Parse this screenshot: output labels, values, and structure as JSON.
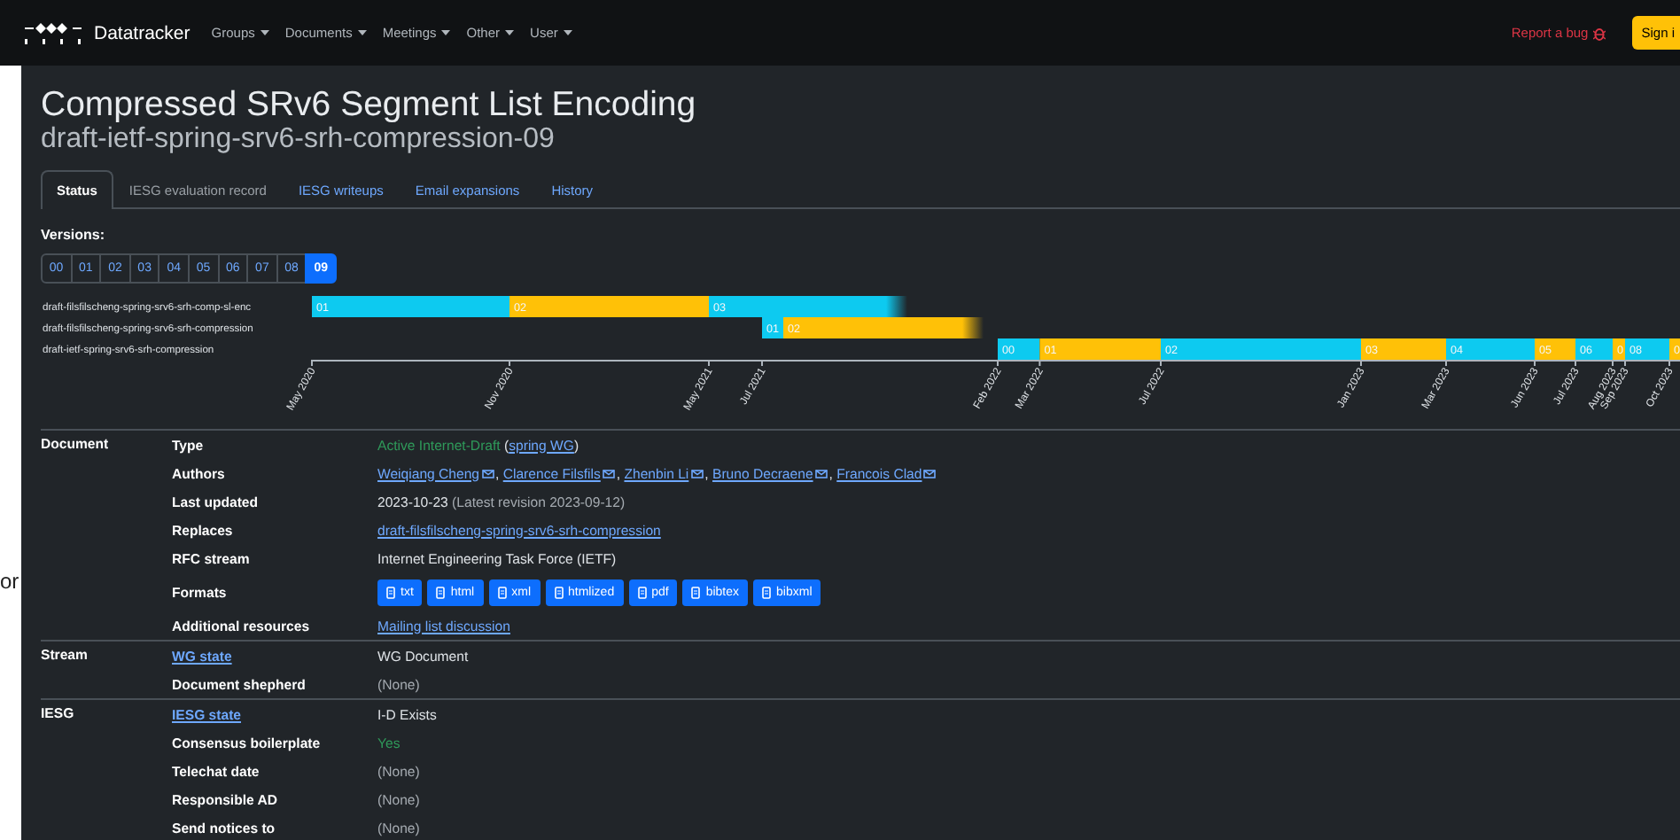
{
  "nav": {
    "brand": "Datatracker",
    "menus": [
      "Groups",
      "Documents",
      "Meetings",
      "Other",
      "User"
    ],
    "report_link": "Report a bug",
    "sign_in": "Sign i"
  },
  "background_text": "or",
  "title": "Compressed SRv6 Segment List Encoding",
  "subtitle": "draft-ietf-spring-srv6-srh-compression-09",
  "tabs": [
    {
      "label": "Status",
      "selected": true,
      "disabled": false
    },
    {
      "label": "IESG evaluation record",
      "selected": false,
      "disabled": true
    },
    {
      "label": "IESG writeups",
      "selected": false,
      "disabled": false
    },
    {
      "label": "Email expansions",
      "selected": false,
      "disabled": false
    },
    {
      "label": "History",
      "selected": false,
      "disabled": false
    }
  ],
  "versions": {
    "label": "Versions:",
    "items": [
      {
        "label": "00",
        "selected": false
      },
      {
        "label": "01",
        "selected": false
      },
      {
        "label": "02",
        "selected": false
      },
      {
        "label": "03",
        "selected": false
      },
      {
        "label": "04",
        "selected": false
      },
      {
        "label": "05",
        "selected": false
      },
      {
        "label": "06",
        "selected": false
      },
      {
        "label": "07",
        "selected": false
      },
      {
        "label": "08",
        "selected": false
      },
      {
        "label": "09",
        "selected": true
      }
    ]
  },
  "timeline": {
    "ticks": [
      "May 2020",
      "Nov 2020",
      "May 2021",
      "Jul 2021",
      "Feb 2022",
      "Mar 2022",
      "Jul 2022",
      "Jan 2023",
      "Mar 2023",
      "Jun 2023",
      "Jul 2023",
      "Aug 2023",
      "Sep 2023",
      "Oct 2023"
    ],
    "rows": [
      {
        "name": "draft-filsfilscheng-spring-srv6-srh-comp-sl-enc",
        "segments": [
          {
            "label": "01",
            "fade": false
          },
          {
            "label": "02",
            "fade": false
          },
          {
            "label": "03",
            "fade": true
          }
        ]
      },
      {
        "name": "draft-filsfilscheng-spring-srv6-srh-compression",
        "segments": [
          {
            "label": "01",
            "fade": false
          },
          {
            "label": "02",
            "fade": true
          }
        ]
      },
      {
        "name": "draft-ietf-spring-srv6-srh-compression",
        "segments": [
          {
            "label": "00",
            "fade": false
          },
          {
            "label": "01",
            "fade": false
          },
          {
            "label": "02",
            "fade": false
          },
          {
            "label": "03",
            "fade": false
          },
          {
            "label": "04",
            "fade": false
          },
          {
            "label": "05",
            "fade": false
          },
          {
            "label": "06",
            "fade": false
          },
          {
            "label": "0",
            "fade": false
          },
          {
            "label": "08",
            "fade": false
          },
          {
            "label": "0",
            "fade": false
          }
        ]
      }
    ]
  },
  "sections": [
    {
      "name": "Document",
      "rows": [
        {
          "label": "Type",
          "link": false,
          "value": [
            {
              "kind": "status",
              "text": "Active Internet-Draft"
            },
            {
              "kind": "plain",
              "text": " ("
            },
            {
              "kind": "link",
              "text": "spring WG"
            },
            {
              "kind": "plain",
              "text": ")"
            }
          ]
        },
        {
          "label": "Authors",
          "link": false,
          "value": [
            {
              "kind": "author",
              "text": "Weiqiang Cheng"
            },
            {
              "kind": "plain",
              "text": ", "
            },
            {
              "kind": "author",
              "text": "Clarence Filsfils"
            },
            {
              "kind": "plain",
              "text": ", "
            },
            {
              "kind": "author",
              "text": "Zhenbin Li"
            },
            {
              "kind": "plain",
              "text": ", "
            },
            {
              "kind": "author",
              "text": "Bruno Decraene"
            },
            {
              "kind": "plain",
              "text": ", "
            },
            {
              "kind": "author",
              "text": "Francois Clad"
            }
          ]
        },
        {
          "label": "Last updated",
          "link": false,
          "value": [
            {
              "kind": "plain",
              "text": "2023-10-23"
            },
            {
              "kind": "muted",
              "text": " (Latest revision 2023-09-12)"
            }
          ]
        },
        {
          "label": "Replaces",
          "link": false,
          "value": [
            {
              "kind": "link",
              "text": "draft-filsfilscheng-spring-srv6-srh-compression"
            }
          ]
        },
        {
          "label": "RFC stream",
          "link": false,
          "value": [
            {
              "kind": "plain",
              "text": "Internet Engineering Task Force (IETF)"
            }
          ]
        },
        {
          "label": "Formats",
          "link": false,
          "value": [
            {
              "kind": "format",
              "text": "txt"
            },
            {
              "kind": "format",
              "text": "html"
            },
            {
              "kind": "format",
              "text": "xml"
            },
            {
              "kind": "format",
              "text": "htmlized"
            },
            {
              "kind": "format",
              "text": "pdf"
            },
            {
              "kind": "format",
              "text": "bibtex"
            },
            {
              "kind": "format",
              "text": "bibxml"
            }
          ]
        },
        {
          "label": "Additional resources",
          "link": false,
          "value": [
            {
              "kind": "link",
              "text": "Mailing list discussion"
            }
          ]
        }
      ]
    },
    {
      "name": "Stream",
      "rows": [
        {
          "label": "WG state",
          "link": true,
          "value": [
            {
              "kind": "plain",
              "text": "WG Document"
            }
          ]
        },
        {
          "label": "Document shepherd",
          "link": false,
          "value": [
            {
              "kind": "muted",
              "text": "(None)"
            }
          ]
        }
      ]
    },
    {
      "name": "IESG",
      "rows": [
        {
          "label": "IESG state",
          "link": true,
          "value": [
            {
              "kind": "plain",
              "text": "I-D Exists"
            }
          ]
        },
        {
          "label": "Consensus boilerplate",
          "link": false,
          "value": [
            {
              "kind": "status",
              "text": "Yes"
            }
          ]
        },
        {
          "label": "Telechat date",
          "link": false,
          "value": [
            {
              "kind": "muted",
              "text": "(None)"
            }
          ]
        },
        {
          "label": "Responsible AD",
          "link": false,
          "value": [
            {
              "kind": "muted",
              "text": "(None)"
            }
          ]
        },
        {
          "label": "Send notices to",
          "link": false,
          "value": [
            {
              "kind": "muted",
              "text": "(None)"
            }
          ]
        }
      ]
    }
  ]
}
